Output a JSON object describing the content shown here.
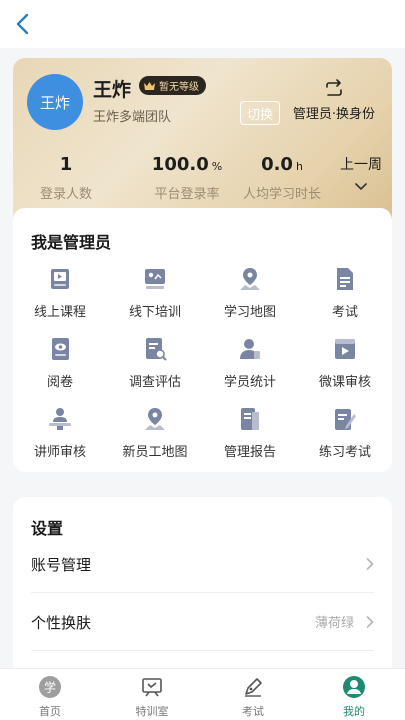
{
  "profile": {
    "avatar_text": "王炸",
    "name": "王炸",
    "level_badge": "暂无等级",
    "team": "王炸多端团队",
    "switch_label": "切换",
    "role_label": "管理员·换身份",
    "stats": [
      {
        "value": "1",
        "unit": "",
        "label": "登录人数"
      },
      {
        "value": "100.0",
        "unit": "%",
        "label": "平台登录率"
      },
      {
        "value": "0.0",
        "unit": "h",
        "label": "人均学习时长"
      }
    ],
    "period": "上一周"
  },
  "admin": {
    "title": "我是管理员",
    "items": [
      {
        "label": "线上课程",
        "icon": "online-course-icon"
      },
      {
        "label": "线下培训",
        "icon": "offline-training-icon"
      },
      {
        "label": "学习地图",
        "icon": "learning-map-icon"
      },
      {
        "label": "考试",
        "icon": "exam-doc-icon"
      },
      {
        "label": "阅卷",
        "icon": "grading-icon"
      },
      {
        "label": "调查评估",
        "icon": "survey-icon"
      },
      {
        "label": "学员统计",
        "icon": "student-stats-icon"
      },
      {
        "label": "微课审核",
        "icon": "micro-course-review-icon"
      },
      {
        "label": "讲师审核",
        "icon": "lecturer-review-icon"
      },
      {
        "label": "新员工地图",
        "icon": "new-staff-map-icon"
      },
      {
        "label": "管理报告",
        "icon": "report-icon"
      },
      {
        "label": "练习考试",
        "icon": "practice-exam-icon"
      }
    ]
  },
  "settings": {
    "title": "设置",
    "rows": [
      {
        "label": "账号管理",
        "value": ""
      },
      {
        "label": "个性换肤",
        "value": "薄荷绿"
      }
    ]
  },
  "tabbar": {
    "tabs": [
      {
        "label": "首页",
        "icon": "home-icon"
      },
      {
        "label": "特训室",
        "icon": "training-room-icon"
      },
      {
        "label": "考试",
        "icon": "exam-pen-icon"
      },
      {
        "label": "我的",
        "icon": "profile-icon"
      }
    ],
    "active_index": 3
  },
  "colors": {
    "accent": "#1f8a70",
    "avatar": "#3f8fe0",
    "icon": "#7a85a3",
    "card_gold": "#e6d2ac"
  }
}
